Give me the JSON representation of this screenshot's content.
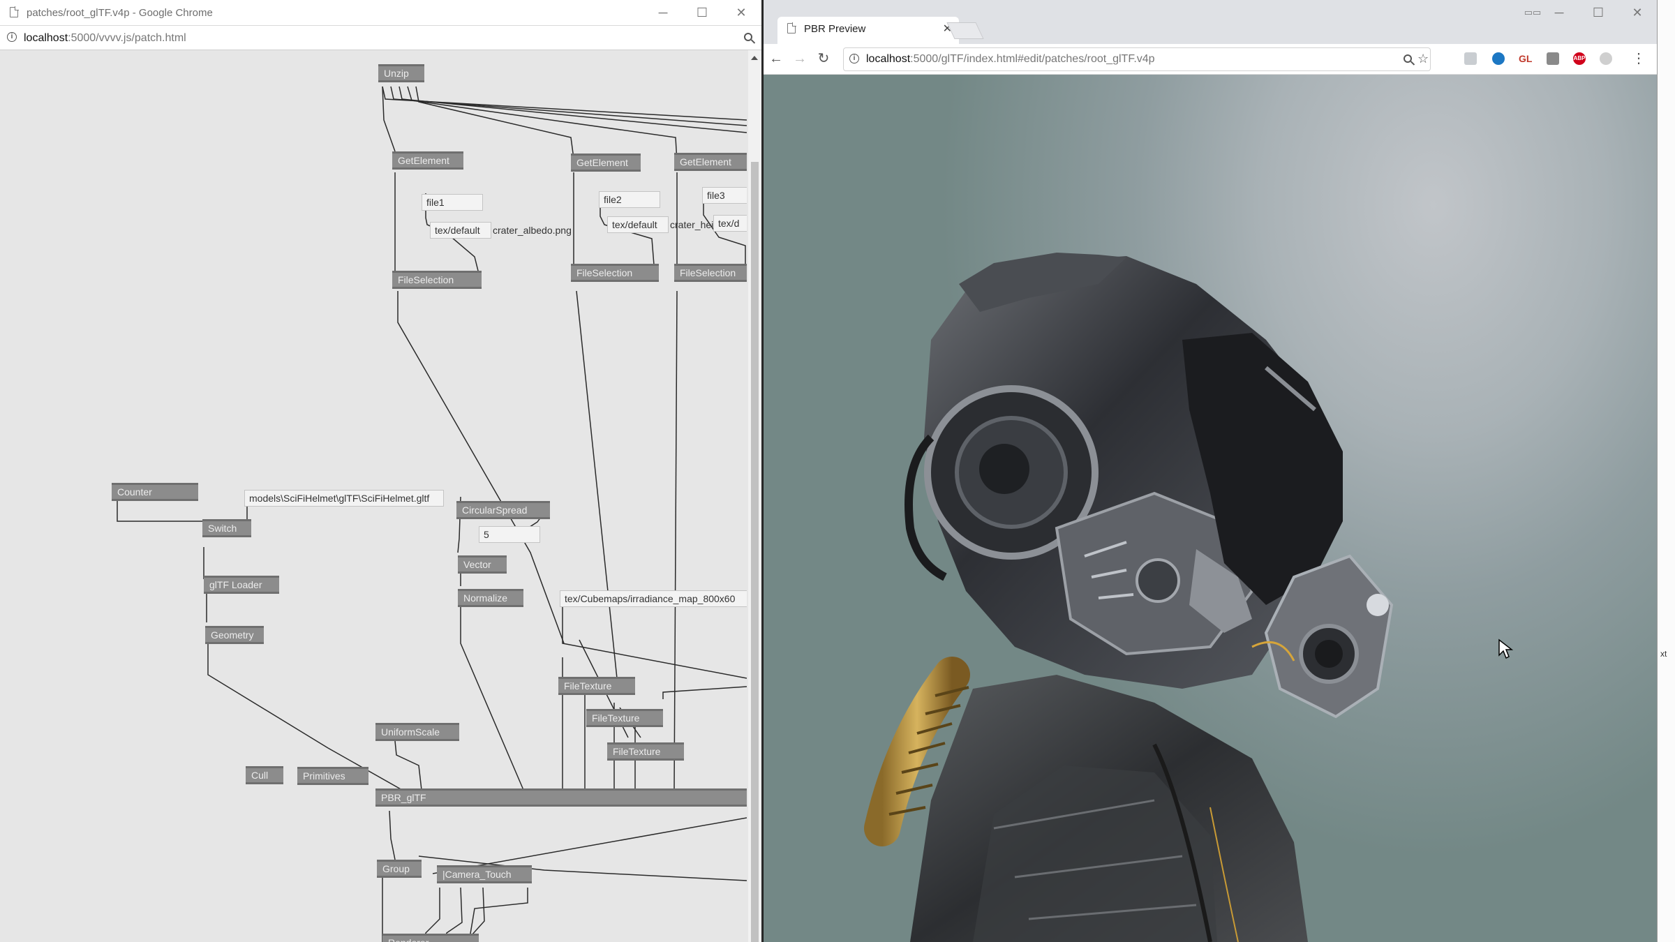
{
  "left_window": {
    "title": "patches/root_glTF.v4p - Google Chrome",
    "url_host": "localhost",
    "url_path": ":5000/vvvv.js/patch.html",
    "controls": {
      "minimize": "─",
      "maximize": "☐",
      "close": "✕"
    }
  },
  "patch": {
    "nodes": {
      "unzip": "Unzip",
      "getelement_1": "GetElement",
      "getelement_2": "GetElement",
      "getelement_3": "GetElement",
      "fileselection_1": "FileSelection",
      "fileselection_2": "FileSelection",
      "fileselection_3": "FileSelection",
      "counter": "Counter",
      "switch": "Switch",
      "gltf_loader": "glTF Loader",
      "geometry": "Geometry",
      "circularspread": "CircularSpread",
      "vector": "Vector",
      "normalize": "Normalize",
      "filetexture_1": "FileTexture",
      "filetexture_2": "FileTexture",
      "filetexture_3": "FileTexture",
      "uniformscale": "UniformScale",
      "cull": "Cull",
      "primitives": "Primitives",
      "pbr_gltf": "PBR_glTF",
      "group": "Group",
      "camera_touch": "|Camera_Touch",
      "renderer": "Renderer"
    },
    "ioboxes": {
      "file1": "file1",
      "file2": "file2",
      "file3": "file3",
      "tex_default_1": "tex/default",
      "crater_albedo": "crater_albedo.png",
      "tex_default_2": "tex/default",
      "crater_hei": "crater_hei",
      "tex_d": "tex/d",
      "models_path": "models\\SciFiHelmet\\glTF\\SciFiHelmet.gltf",
      "spread_count": "5",
      "cubemap_path": "tex/Cubemaps/irradiance_map_800x60"
    }
  },
  "right_window": {
    "tab_title": "PBR Preview",
    "tab_close": "✕",
    "url_host": "localhost",
    "url_path": ":5000/glTF/index.html#edit/patches/root_glTF.v4p",
    "nav": {
      "back": "←",
      "forward": "→",
      "reload": "↻"
    },
    "controls": {
      "minimize": "─",
      "maximize": "☐",
      "close": "✕"
    },
    "extensions": [
      "shield-icon",
      "eye-icon",
      "GL",
      "chat-icon",
      "ABP",
      "circle-icon"
    ],
    "ext_gl_label": "GL",
    "ext_abp_label": "ABP",
    "menu": "⋮"
  },
  "edge_text": "xt",
  "colors": {
    "patch_bg": "#e6e6e6",
    "node": "#8c8c8c",
    "link": "#2a2a2a",
    "viewport_bg": "#9aa6a8"
  }
}
